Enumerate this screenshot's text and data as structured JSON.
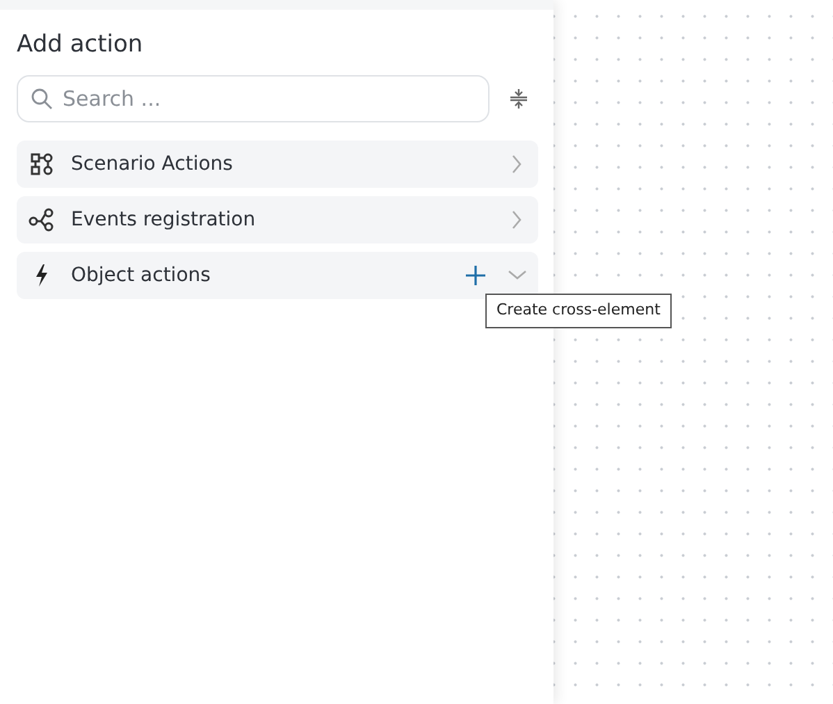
{
  "panel": {
    "title": "Add action",
    "search": {
      "placeholder": "Search ..."
    },
    "groups": [
      {
        "kind": "scenario",
        "label": "Scenario Actions",
        "expanded": false,
        "add_button": false
      },
      {
        "kind": "events",
        "label": "Events registration",
        "expanded": false,
        "add_button": false
      },
      {
        "kind": "object",
        "label": "Object actions",
        "expanded": false,
        "add_button": true
      }
    ],
    "tooltip": "Create cross-element"
  }
}
